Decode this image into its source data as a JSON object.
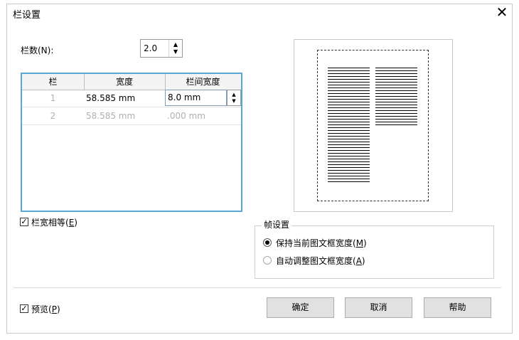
{
  "dialog": {
    "title": "栏设置",
    "close_glyph": "✕"
  },
  "columns_count": {
    "label": "栏数(N):",
    "value": "2.0",
    "up": "▲",
    "down": "▼"
  },
  "table": {
    "headers": [
      "栏",
      "宽度",
      "栏间宽度"
    ],
    "rows": [
      {
        "index": "1",
        "width": "58.585 mm",
        "gutter": "8.0 mm"
      },
      {
        "index": "2",
        "width": "58.585 mm",
        "gutter": ".000 mm"
      }
    ]
  },
  "equal_width": {
    "checked": true,
    "label_text": "栏宽相等(",
    "label_key": "E",
    "label_end": ")"
  },
  "frame_settings": {
    "title": "帧设置",
    "option1": {
      "text": "保持当前图文框宽度(",
      "key": "M",
      "end": ")",
      "selected": true
    },
    "option2": {
      "text": "自动调整图文框宽度(",
      "key": "A",
      "end": ")",
      "selected": false
    }
  },
  "preview_checkbox": {
    "checked": true,
    "label_text": "预览(",
    "label_key": "P",
    "label_end": ")"
  },
  "buttons": {
    "ok": "确定",
    "cancel": "取消",
    "help": "帮助"
  },
  "checkmark": "✓",
  "colors": {
    "grid_border": "#57a8d8",
    "button_bg": "#e1e1e1"
  }
}
